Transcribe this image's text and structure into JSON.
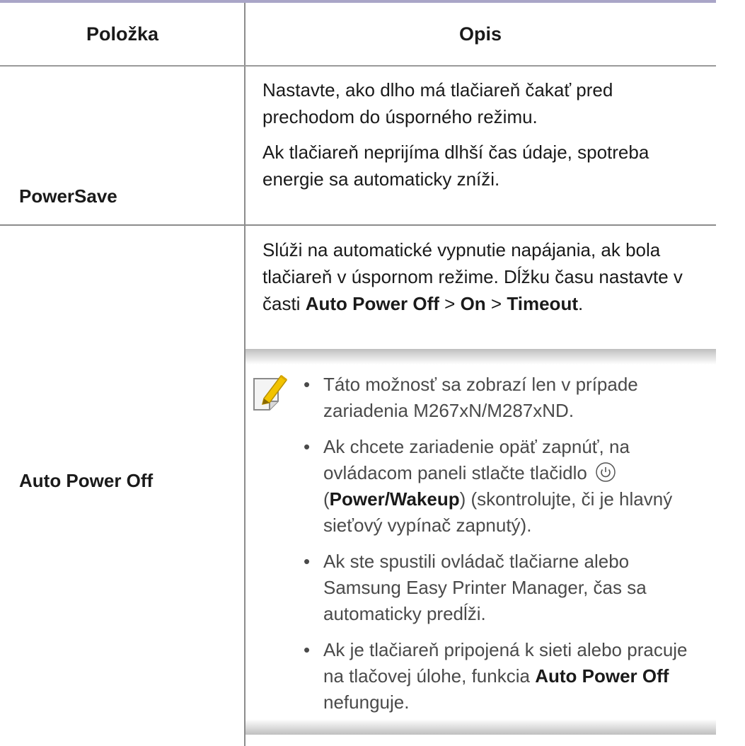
{
  "header": {
    "col_item": "Položka",
    "col_desc": "Opis"
  },
  "rows": [
    {
      "label": "PowerSave",
      "desc_lines": [
        "Nastavte, ako dlho má tlačiareň čakať pred prechodom do úsporného režimu.",
        "Ak tlačiareň neprijíma dlhší čas údaje, spotreba energie sa automaticky zníži."
      ]
    },
    {
      "label": "Auto Power Off",
      "desc_intro": "Slúži na automatické vypnutie napájania, ak bola tlačiareň v úspornom režime. Dĺžku času nastavte v časti",
      "desc_path": {
        "a": "Auto Power Off",
        "sep1": ">",
        "b": "On",
        "sep2": ">",
        "c": "Timeout",
        "end": "."
      },
      "note": {
        "icon": "note-pencil-icon",
        "bullets": [
          {
            "text": "Táto možnosť sa zobrazí len v prípade zariadenia M267xN/M287xND."
          },
          {
            "pre": "Ak chcete zariadenie opäť zapnúť, na ovládacom paneli stlačte tlačidlo",
            "icon": "power-button-icon",
            "open": "(",
            "bold": "Power/Wakeup",
            "post": ") (skontrolujte, či je hlavný sieťový vypínač zapnutý)."
          },
          {
            "text": "Ak ste spustili ovládač tlačiarne alebo Samsung Easy Printer Manager, čas sa automaticky predĺži."
          },
          {
            "pre": "Ak je tlačiareň pripojená k sieti alebo pracuje na tlačovej úlohe, funkcia",
            "bold": "Auto Power Off",
            "post": "nefunguje."
          }
        ]
      }
    }
  ],
  "colors": {
    "header_rule": "#a9a5c7",
    "grid_line": "#8c8c8c",
    "note_text": "#4a4a4a"
  }
}
